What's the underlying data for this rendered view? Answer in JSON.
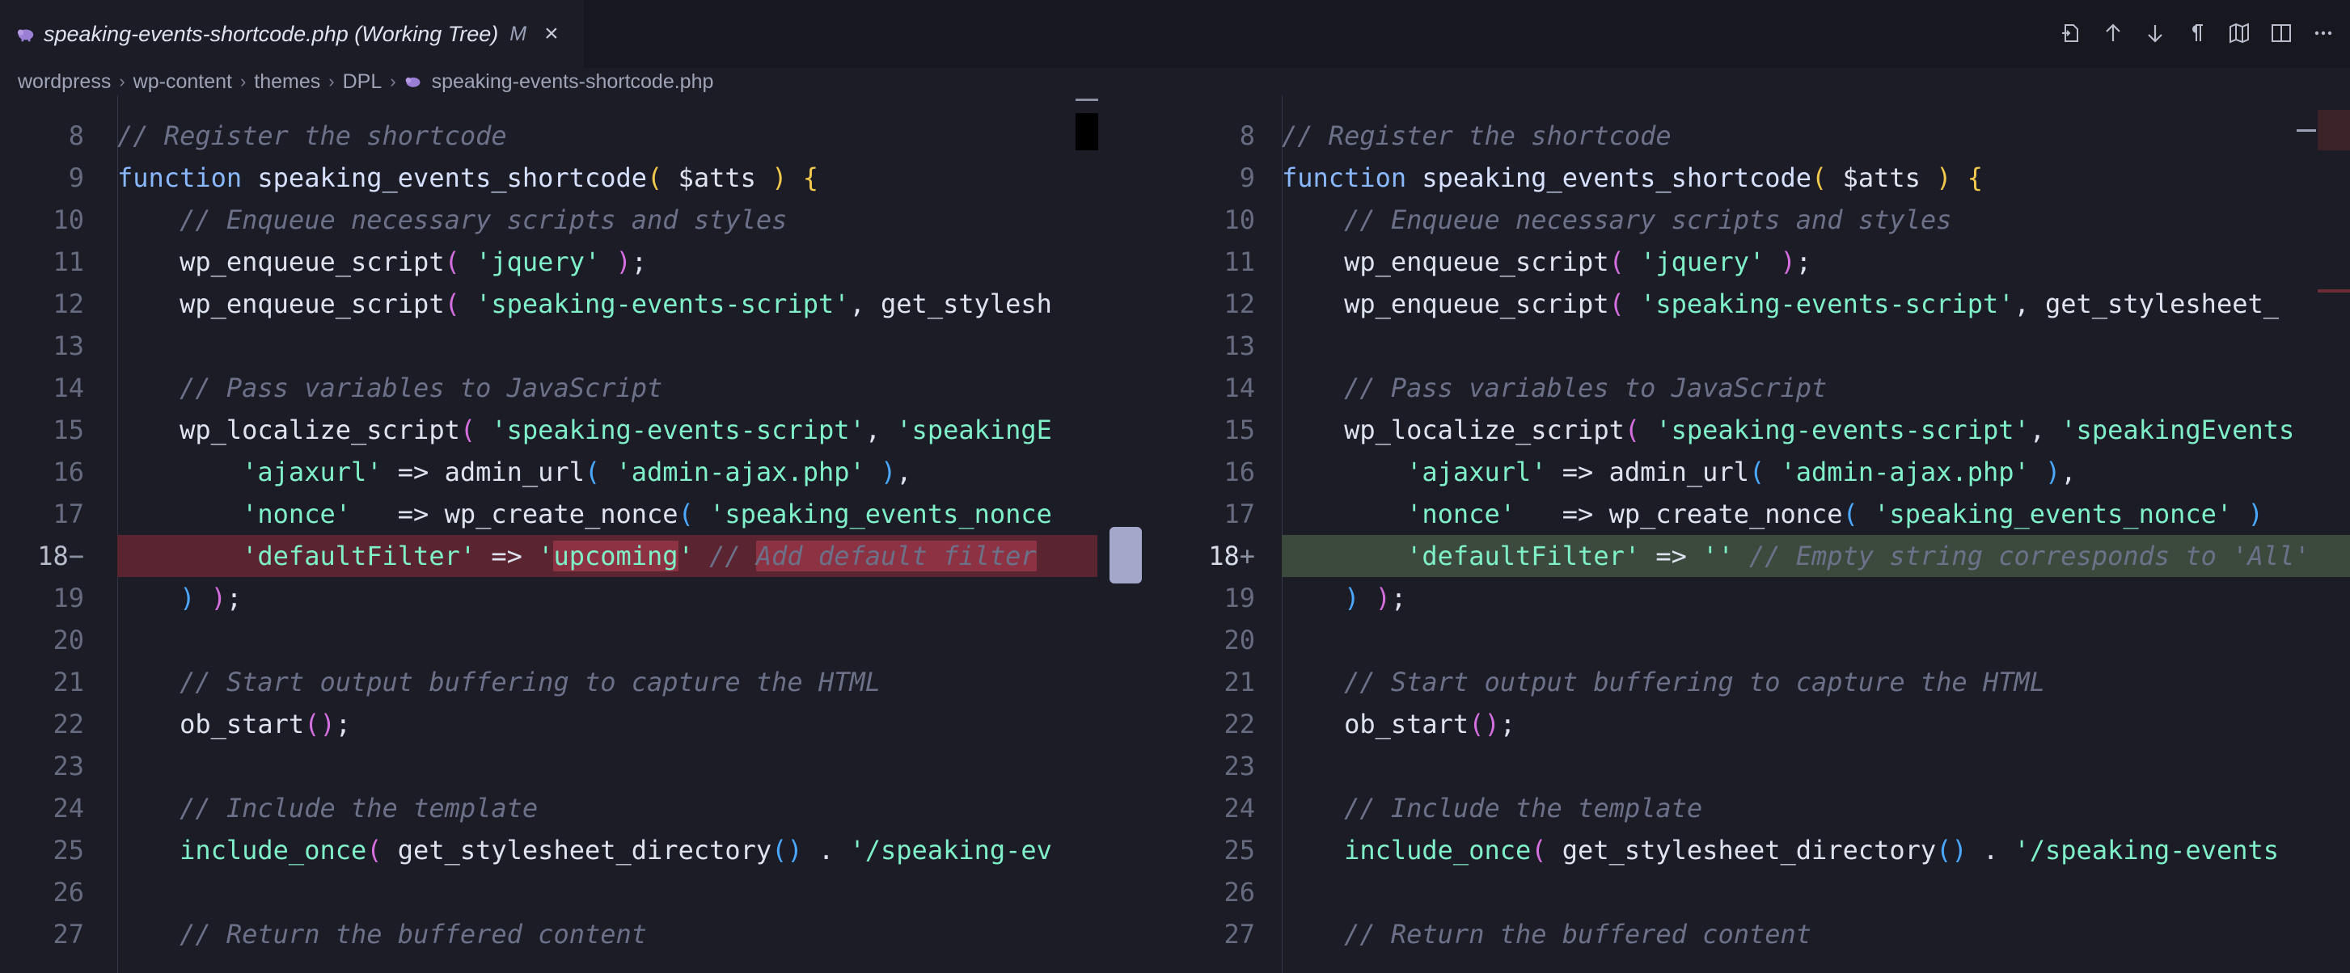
{
  "tab": {
    "title": "speaking-events-shortcode.php (Working Tree)",
    "status": "M",
    "close": "×"
  },
  "toolbar": [
    {
      "name": "open-file-icon"
    },
    {
      "name": "arrow-up-icon"
    },
    {
      "name": "arrow-down-icon"
    },
    {
      "name": "pilcrow-icon"
    },
    {
      "name": "map-icon"
    },
    {
      "name": "split-editor-icon"
    },
    {
      "name": "more-actions-icon"
    }
  ],
  "breadcrumb": [
    "wordpress",
    "wp-content",
    "themes",
    "DPL",
    "speaking-events-shortcode.php"
  ],
  "colors": {
    "accent": "#a3a7c9",
    "removed_bg": "#5a2430",
    "added_bg": "#3b4a3d"
  },
  "left_lines": [
    {
      "n": "8",
      "tokens": [
        [
          "cm",
          "// Register the shortcode"
        ]
      ]
    },
    {
      "n": "9",
      "tokens": [
        [
          "kw",
          "function "
        ],
        [
          "fn",
          "speaking_events_shortcode"
        ],
        [
          "b1",
          "( "
        ],
        [
          "vr",
          "$atts "
        ],
        [
          "b1",
          ") {"
        ]
      ]
    },
    {
      "n": "10",
      "tokens": [
        [
          "pn",
          "    "
        ],
        [
          "cm",
          "// Enqueue necessary scripts and styles"
        ]
      ]
    },
    {
      "n": "11",
      "tokens": [
        [
          "pn",
          "    wp_enqueue_script"
        ],
        [
          "b2",
          "( "
        ],
        [
          "sx",
          "'jquery'"
        ],
        [
          "b2",
          " )"
        ],
        [
          "pn",
          ";"
        ]
      ]
    },
    {
      "n": "12",
      "tokens": [
        [
          "pn",
          "    wp_enqueue_script"
        ],
        [
          "b2",
          "( "
        ],
        [
          "sx",
          "'speaking-events-script'"
        ],
        [
          "pn",
          ", get_stylesh"
        ]
      ]
    },
    {
      "n": "13",
      "tokens": []
    },
    {
      "n": "14",
      "tokens": [
        [
          "pn",
          "    "
        ],
        [
          "cm",
          "// Pass variables to JavaScript"
        ]
      ]
    },
    {
      "n": "15",
      "tokens": [
        [
          "pn",
          "    wp_localize_script"
        ],
        [
          "b2",
          "( "
        ],
        [
          "sx",
          "'speaking-events-script'"
        ],
        [
          "pn",
          ", "
        ],
        [
          "sx",
          "'speakingE"
        ]
      ]
    },
    {
      "n": "16",
      "tokens": [
        [
          "pn",
          "        "
        ],
        [
          "sx",
          "'ajaxurl'"
        ],
        [
          "pn",
          " => admin_url"
        ],
        [
          "b3",
          "( "
        ],
        [
          "sx",
          "'admin-ajax.php'"
        ],
        [
          "b3",
          " )"
        ],
        [
          "pn",
          ","
        ]
      ]
    },
    {
      "n": "17",
      "tokens": [
        [
          "pn",
          "        "
        ],
        [
          "sx",
          "'nonce'"
        ],
        [
          "pn",
          "   => wp_create_nonce"
        ],
        [
          "b3",
          "( "
        ],
        [
          "sx",
          "'speaking_events_nonce"
        ]
      ]
    },
    {
      "n": "18",
      "mark": "−",
      "type": "removed",
      "tokens": [
        [
          "pn",
          "        "
        ],
        [
          "sx",
          "'defaultFilter'"
        ],
        [
          "pn",
          " => "
        ],
        [
          "sx",
          "'"
        ],
        [
          "sxh",
          "upcoming"
        ],
        [
          "sx",
          "'"
        ],
        [
          "pn",
          " "
        ],
        [
          "cm",
          "// "
        ],
        [
          "cmh",
          "Add default filter"
        ]
      ]
    },
    {
      "n": "19",
      "tokens": [
        [
          "pn",
          "    "
        ],
        [
          "b3",
          ")"
        ],
        [
          "pn",
          " "
        ],
        [
          "b2",
          ")"
        ],
        [
          "pn",
          ";"
        ]
      ]
    },
    {
      "n": "20",
      "tokens": []
    },
    {
      "n": "21",
      "tokens": [
        [
          "pn",
          "    "
        ],
        [
          "cm",
          "// Start output buffering to capture the HTML"
        ]
      ]
    },
    {
      "n": "22",
      "tokens": [
        [
          "pn",
          "    ob_start"
        ],
        [
          "b2",
          "()"
        ],
        [
          "pn",
          ";"
        ]
      ]
    },
    {
      "n": "23",
      "tokens": []
    },
    {
      "n": "24",
      "tokens": [
        [
          "pn",
          "    "
        ],
        [
          "cm",
          "// Include the template"
        ]
      ]
    },
    {
      "n": "25",
      "tokens": [
        [
          "pn",
          "    "
        ],
        [
          "sx",
          "include_once"
        ],
        [
          "b2",
          "( "
        ],
        [
          "pn",
          "get_stylesheet_directory"
        ],
        [
          "b3",
          "()"
        ],
        [
          "pn",
          " . "
        ],
        [
          "sx",
          "'/speaking-ev"
        ]
      ]
    },
    {
      "n": "26",
      "tokens": []
    },
    {
      "n": "27",
      "tokens": [
        [
          "pn",
          "    "
        ],
        [
          "cm",
          "// Return the buffered content"
        ]
      ]
    }
  ],
  "right_lines": [
    {
      "n": "8",
      "tokens": [
        [
          "cm",
          "// Register the shortcode"
        ]
      ]
    },
    {
      "n": "9",
      "tokens": [
        [
          "kw",
          "function "
        ],
        [
          "fn",
          "speaking_events_shortcode"
        ],
        [
          "b1",
          "( "
        ],
        [
          "vr",
          "$atts "
        ],
        [
          "b1",
          ") {"
        ]
      ]
    },
    {
      "n": "10",
      "tokens": [
        [
          "pn",
          "    "
        ],
        [
          "cm",
          "// Enqueue necessary scripts and styles"
        ]
      ]
    },
    {
      "n": "11",
      "tokens": [
        [
          "pn",
          "    wp_enqueue_script"
        ],
        [
          "b2",
          "( "
        ],
        [
          "sx",
          "'jquery'"
        ],
        [
          "b2",
          " )"
        ],
        [
          "pn",
          ";"
        ]
      ]
    },
    {
      "n": "12",
      "tokens": [
        [
          "pn",
          "    wp_enqueue_script"
        ],
        [
          "b2",
          "( "
        ],
        [
          "sx",
          "'speaking-events-script'"
        ],
        [
          "pn",
          ", get_stylesheet_"
        ]
      ]
    },
    {
      "n": "13",
      "tokens": []
    },
    {
      "n": "14",
      "tokens": [
        [
          "pn",
          "    "
        ],
        [
          "cm",
          "// Pass variables to JavaScript"
        ]
      ]
    },
    {
      "n": "15",
      "tokens": [
        [
          "pn",
          "    wp_localize_script"
        ],
        [
          "b2",
          "( "
        ],
        [
          "sx",
          "'speaking-events-script'"
        ],
        [
          "pn",
          ", "
        ],
        [
          "sx",
          "'speakingEvents"
        ]
      ]
    },
    {
      "n": "16",
      "tokens": [
        [
          "pn",
          "        "
        ],
        [
          "sx",
          "'ajaxurl'"
        ],
        [
          "pn",
          " => admin_url"
        ],
        [
          "b3",
          "( "
        ],
        [
          "sx",
          "'admin-ajax.php'"
        ],
        [
          "b3",
          " )"
        ],
        [
          "pn",
          ","
        ]
      ]
    },
    {
      "n": "17",
      "tokens": [
        [
          "pn",
          "        "
        ],
        [
          "sx",
          "'nonce'"
        ],
        [
          "pn",
          "   => wp_create_nonce"
        ],
        [
          "b3",
          "( "
        ],
        [
          "sx",
          "'speaking_events_nonce'"
        ],
        [
          "b3",
          " )"
        ]
      ]
    },
    {
      "n": "18",
      "mark": "+",
      "type": "added",
      "tokens": [
        [
          "pn",
          "        "
        ],
        [
          "sx",
          "'defaultFilter'"
        ],
        [
          "pn",
          " => "
        ],
        [
          "sx",
          "''"
        ],
        [
          "pn",
          " "
        ],
        [
          "cm",
          "// Empty string corresponds to 'All'"
        ]
      ]
    },
    {
      "n": "19",
      "tokens": [
        [
          "pn",
          "    "
        ],
        [
          "b3",
          ")"
        ],
        [
          "pn",
          " "
        ],
        [
          "b2",
          ")"
        ],
        [
          "pn",
          ";"
        ]
      ]
    },
    {
      "n": "20",
      "tokens": []
    },
    {
      "n": "21",
      "tokens": [
        [
          "pn",
          "    "
        ],
        [
          "cm",
          "// Start output buffering to capture the HTML"
        ]
      ]
    },
    {
      "n": "22",
      "tokens": [
        [
          "pn",
          "    ob_start"
        ],
        [
          "b2",
          "()"
        ],
        [
          "pn",
          ";"
        ]
      ]
    },
    {
      "n": "23",
      "tokens": []
    },
    {
      "n": "24",
      "tokens": [
        [
          "pn",
          "    "
        ],
        [
          "cm",
          "// Include the template"
        ]
      ]
    },
    {
      "n": "25",
      "tokens": [
        [
          "pn",
          "    "
        ],
        [
          "sx",
          "include_once"
        ],
        [
          "b2",
          "( "
        ],
        [
          "pn",
          "get_stylesheet_directory"
        ],
        [
          "b3",
          "()"
        ],
        [
          "pn",
          " . "
        ],
        [
          "sx",
          "'/speaking-events"
        ]
      ]
    },
    {
      "n": "26",
      "tokens": []
    },
    {
      "n": "27",
      "tokens": [
        [
          "pn",
          "    "
        ],
        [
          "cm",
          "// Return the buffered content"
        ]
      ]
    }
  ]
}
